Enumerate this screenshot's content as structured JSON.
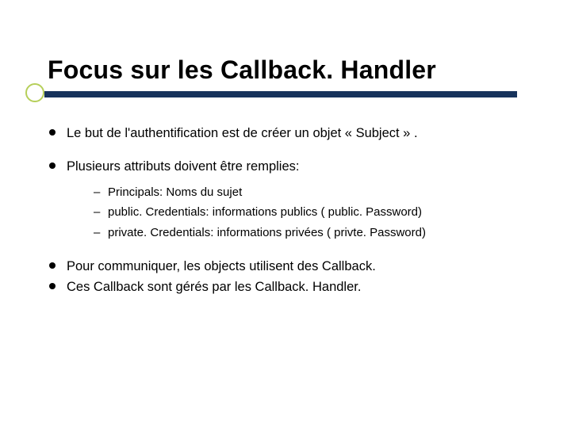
{
  "title": "Focus sur les Callback. Handler",
  "bullets": {
    "b1": "Le but de l'authentification est de créer un objet « Subject » .",
    "b2": "Plusieurs attributs doivent être remplies:",
    "sub": {
      "s1": "Principals: Noms du sujet",
      "s2": "public. Credentials: informations publics ( public. Password)",
      "s3": "private. Credentials: informations privées ( privte. Password)"
    },
    "b3": "Pour communiquer, les objects utilisent des Callback.",
    "b4": "Ces Callback sont gérés par les Callback. Handler."
  }
}
